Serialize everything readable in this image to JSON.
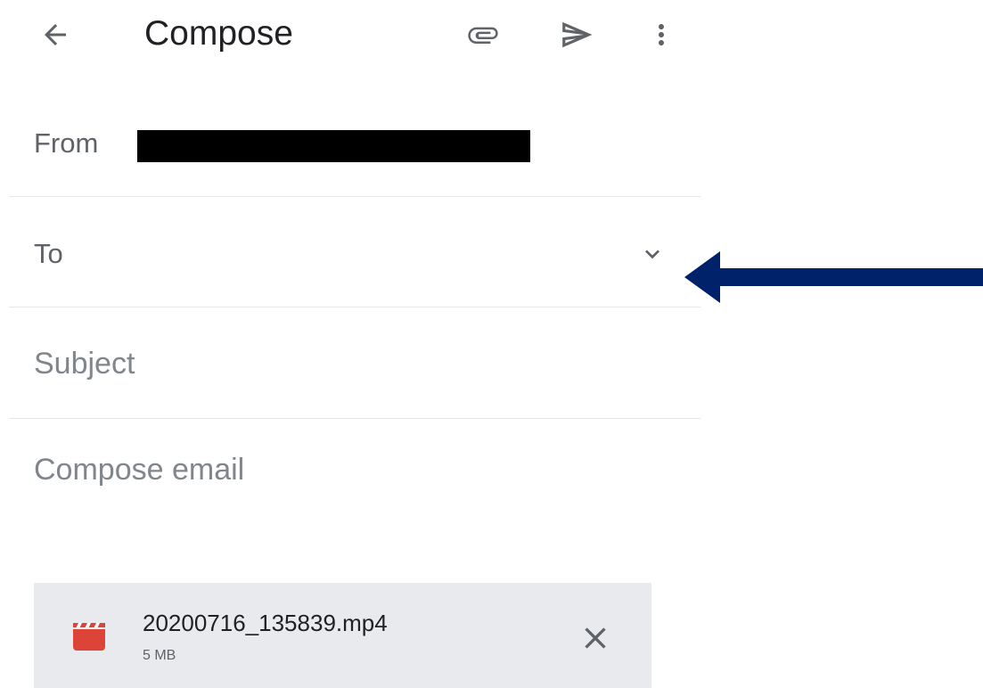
{
  "header": {
    "title": "Compose",
    "back_icon": "arrow-back-icon",
    "attach_icon": "paperclip-icon",
    "send_icon": "send-icon",
    "more_icon": "more-vert-icon"
  },
  "form": {
    "from_label": "From",
    "to_label": "To",
    "to_expand_icon": "chevron-down-icon",
    "subject_placeholder": "Subject",
    "body_placeholder": "Compose email"
  },
  "attachment": {
    "name": "20200716_135839.mp4",
    "size": "5 MB",
    "type_icon": "video-clapperboard-icon",
    "remove_icon": "close-icon"
  },
  "colors": {
    "attachment_icon": "#db4437",
    "attachment_bg": "#e8eaed",
    "annotation_arrow": "#00226a"
  }
}
